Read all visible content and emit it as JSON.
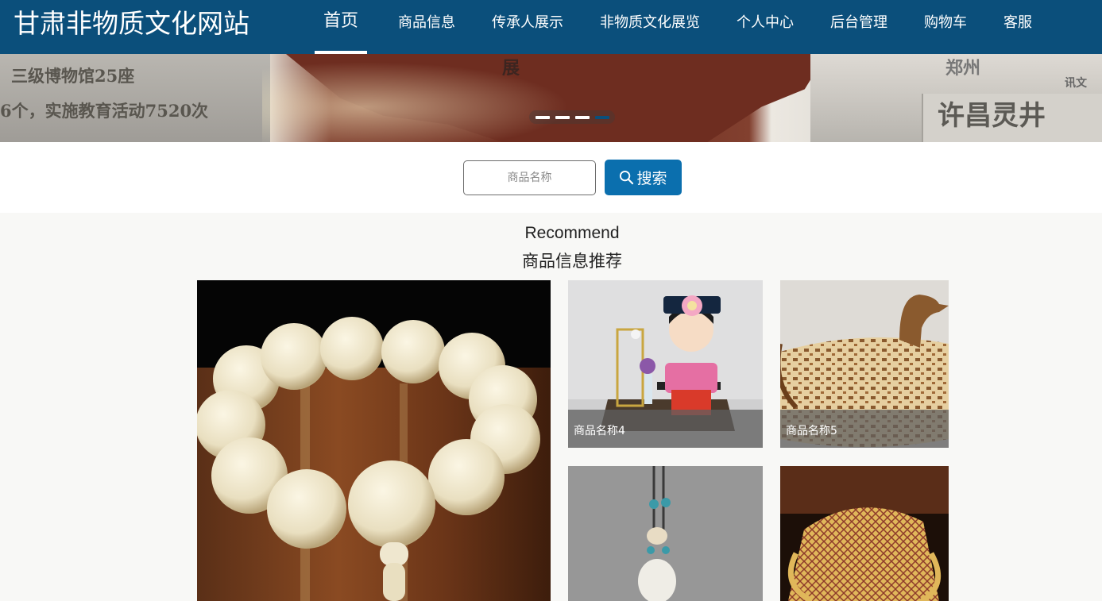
{
  "site": {
    "title": "甘肃非物质文化网站"
  },
  "nav": {
    "items": [
      {
        "label": "首页",
        "active": true
      },
      {
        "label": "商品信息",
        "active": false
      },
      {
        "label": "传承人展示",
        "active": false
      },
      {
        "label": "非物质文化展览",
        "active": false
      },
      {
        "label": "个人中心",
        "active": false
      },
      {
        "label": "后台管理",
        "active": false
      },
      {
        "label": "购物车",
        "active": false
      },
      {
        "label": "客服",
        "active": false
      }
    ]
  },
  "banner": {
    "texts": [
      "三级博物馆25座",
      "6个，实施教育活动7520次",
      "展",
      "许昌灵井",
      "郑州",
      "讯文"
    ],
    "slide_count": 4,
    "active_slide": 4
  },
  "search": {
    "placeholder": "商品名称",
    "button_label": "搜索"
  },
  "recommend": {
    "title_en": "Recommend",
    "title_zh": "商品信息推荐"
  },
  "products": [
    {
      "name": "",
      "image": "white-bead-bracelet"
    },
    {
      "name": "商品名称4",
      "image": "qing-doll-figurine"
    },
    {
      "name": "商品名称5",
      "image": "woven-duck-basket"
    },
    {
      "name": "",
      "image": "white-pendant-necklace"
    },
    {
      "name": "",
      "image": "bamboo-woven-basket"
    }
  ],
  "colors": {
    "header": "#0b4f7b",
    "button": "#0b6fae",
    "background": "#f8f8f6"
  }
}
